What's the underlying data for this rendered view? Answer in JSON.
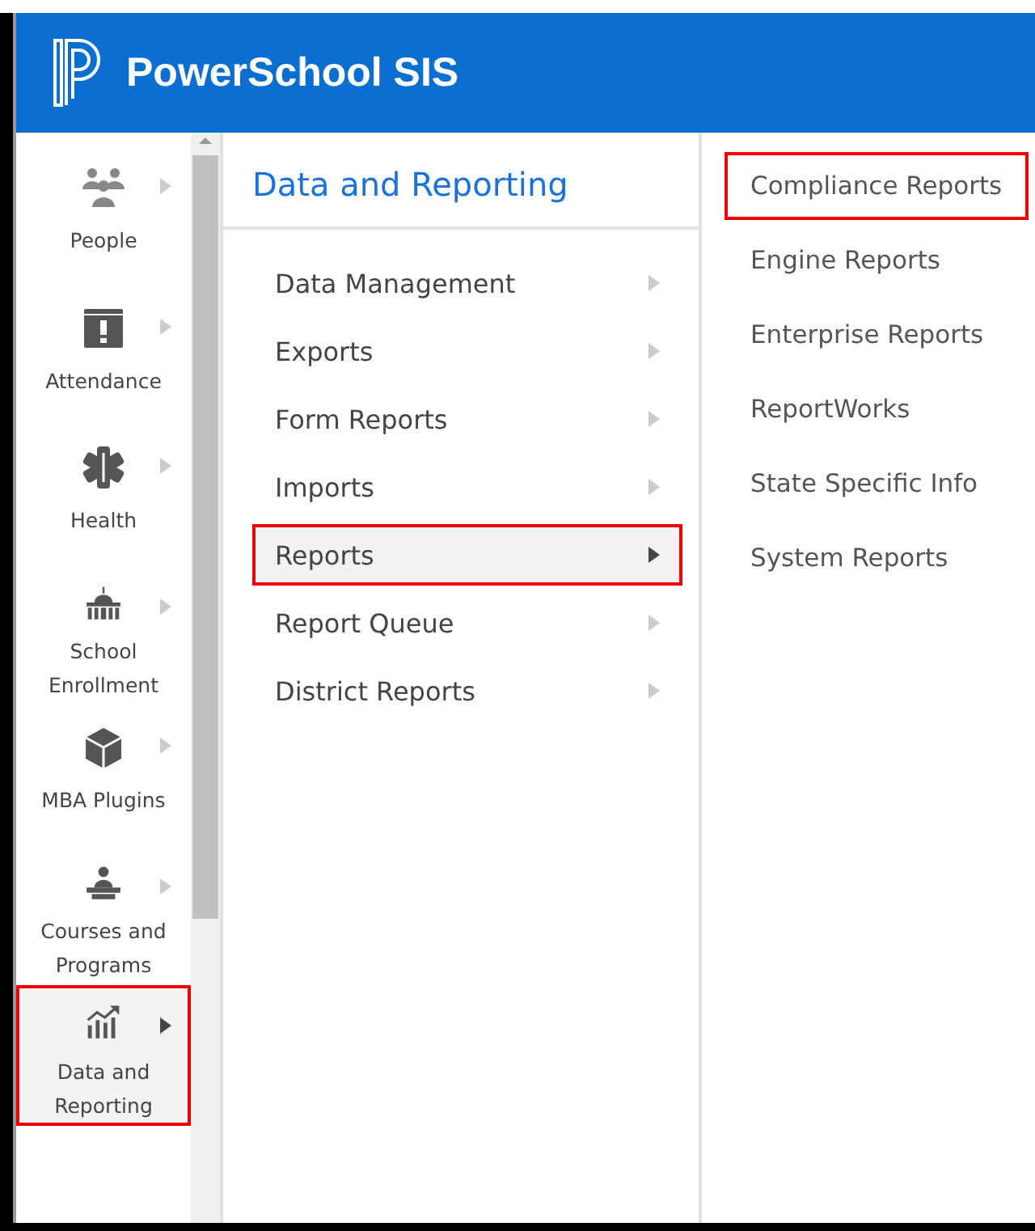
{
  "header": {
    "title": "PowerSchool SIS"
  },
  "nav": [
    {
      "label": "People",
      "kind": "people",
      "selected": false,
      "highlighted": false
    },
    {
      "label": "Attendance",
      "kind": "calendar",
      "selected": false,
      "highlighted": false
    },
    {
      "label": "Health",
      "kind": "health",
      "selected": false,
      "highlighted": false
    },
    {
      "label": "School Enrollment",
      "kind": "school",
      "selected": false,
      "highlighted": false
    },
    {
      "label": "MBA Plugins",
      "kind": "cube",
      "selected": false,
      "highlighted": false
    },
    {
      "label": "Courses and Programs",
      "kind": "teacher",
      "selected": false,
      "highlighted": false
    },
    {
      "label": "Data and Reporting",
      "kind": "chart",
      "selected": true,
      "highlighted": true
    }
  ],
  "menu": {
    "title": "Data and Reporting",
    "items": [
      {
        "label": "Data Management",
        "selected": false,
        "highlighted": false
      },
      {
        "label": "Exports",
        "selected": false,
        "highlighted": false
      },
      {
        "label": "Form Reports",
        "selected": false,
        "highlighted": false
      },
      {
        "label": "Imports",
        "selected": false,
        "highlighted": false
      },
      {
        "label": "Reports",
        "selected": true,
        "highlighted": true
      },
      {
        "label": "Report Queue",
        "selected": false,
        "highlighted": false
      },
      {
        "label": "District Reports",
        "selected": false,
        "highlighted": false
      }
    ]
  },
  "submenu": [
    {
      "label": "Compliance Reports",
      "highlighted": true
    },
    {
      "label": "Engine Reports",
      "highlighted": false
    },
    {
      "label": "Enterprise Reports",
      "highlighted": false
    },
    {
      "label": "ReportWorks",
      "highlighted": false
    },
    {
      "label": "State Specific Info",
      "highlighted": false
    },
    {
      "label": "System Reports",
      "highlighted": false
    }
  ]
}
